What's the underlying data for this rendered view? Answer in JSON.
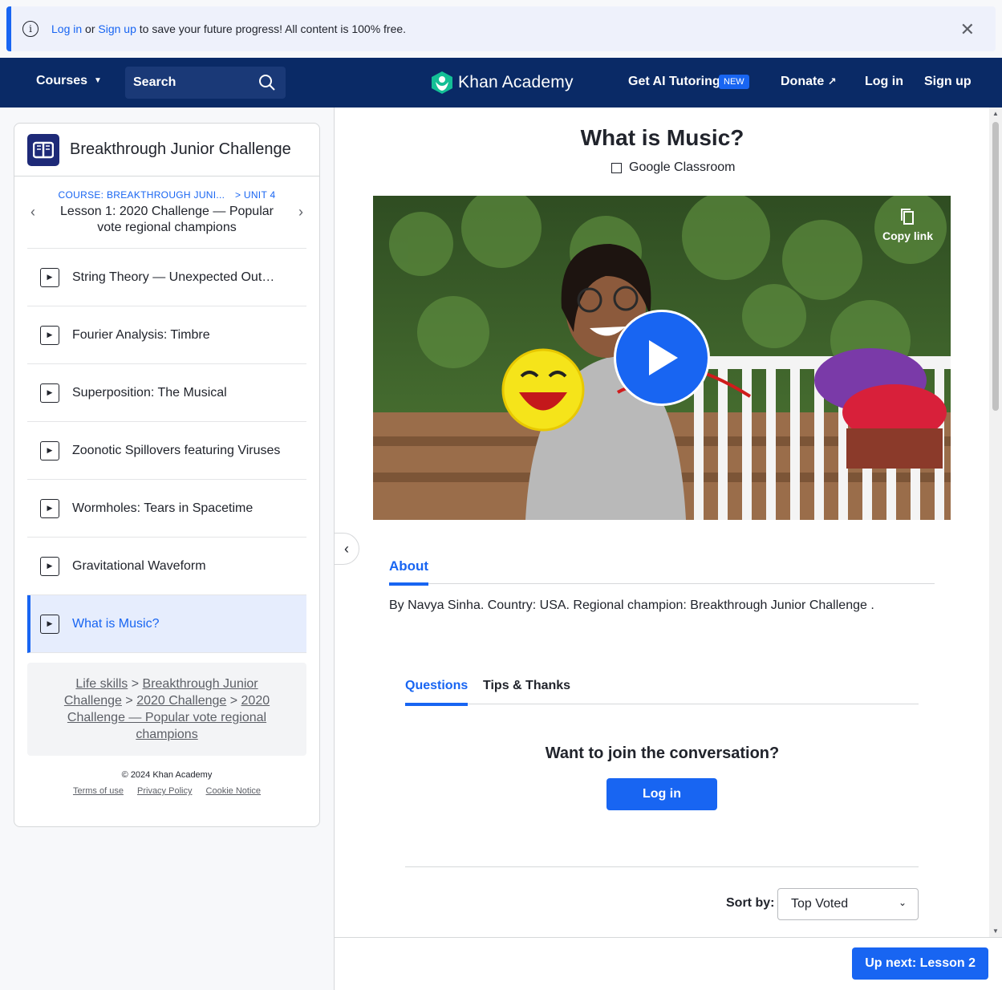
{
  "banner": {
    "login_link": "Log in",
    "or_text": " or ",
    "signup_link": "Sign up",
    "message": " to save your future progress! All content is 100% free."
  },
  "header": {
    "courses": "Courses",
    "search_label": "Search",
    "logo_name": "Khan Academy",
    "ai_tutoring": "Get AI Tutoring",
    "new_badge": "NEW",
    "donate": "Donate",
    "login": "Log in",
    "signup": "Sign up"
  },
  "sidebar": {
    "title": "Breakthrough Junior Challenge",
    "course_crumb": "COURSE: BREAKTHROUGH JUNI...",
    "unit_crumb": "> UNIT 4",
    "lesson_title": "Lesson 1: 2020 Challenge — Popular vote regional champions",
    "items": [
      {
        "label": "String Theory — Unexpected Outco..."
      },
      {
        "label": "Fourier Analysis: Timbre"
      },
      {
        "label": "Superposition: The Musical"
      },
      {
        "label": "Zoonotic Spillovers featuring Viruses"
      },
      {
        "label": "Wormholes: Tears in Spacetime"
      },
      {
        "label": "Gravitational Waveform"
      },
      {
        "label": "What is Music?"
      }
    ],
    "breadcrumb": {
      "life_skills": "Life skills",
      "bjc": "Breakthrough Junior Challenge",
      "challenge2020": "2020 Challenge",
      "lesson": "2020 Challenge — Popular vote regional champions",
      "sep": ">"
    },
    "footer": {
      "copyright": "© 2024 Khan Academy",
      "terms": "Terms of use",
      "privacy": "Privacy Policy",
      "cookie": "Cookie Notice"
    }
  },
  "main": {
    "title": "What is Music?",
    "google_classroom": "Google Classroom",
    "copy_link": "Copy link",
    "tab_about": "About",
    "about_text": "By Navya Sinha. Country: USA. Regional champion: Breakthrough Junior Challenge .",
    "tab_questions": "Questions",
    "tab_tips": "Tips & Thanks",
    "join_text": "Want to join the conversation?",
    "login_button": "Log in",
    "sort_label": "Sort by:",
    "sort_value": "Top Voted"
  },
  "bottom": {
    "next_button": "Up next: Lesson 2"
  },
  "colors": {
    "accent": "#1865f2",
    "header_bg": "#0a2a66",
    "logo_green": "#14bf96"
  }
}
